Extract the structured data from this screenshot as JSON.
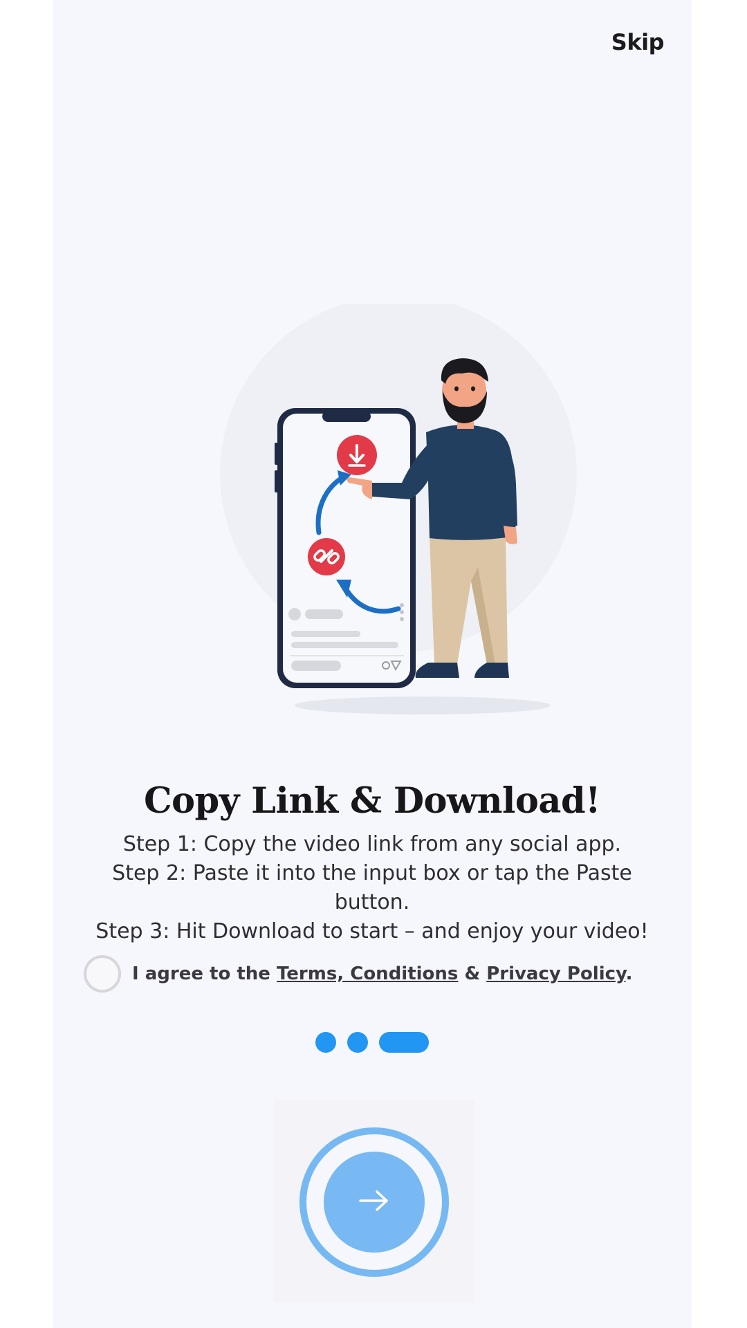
{
  "header": {
    "skip_label": "Skip"
  },
  "illustration": {
    "icon": "person-pointing-at-phone-illustration"
  },
  "content": {
    "title": "Copy Link & Download!",
    "steps": [
      "Step 1: Copy the video link from any social app.",
      "Step 2: Paste it into the input box or tap the Paste button.",
      "Step 3: Hit Download to start – and enjoy your video!"
    ]
  },
  "agreement": {
    "prefix": "I agree to the ",
    "terms_link": "Terms, Conditions",
    "separator": " & ",
    "privacy_link": "Privacy Policy",
    "suffix": ".",
    "checked": false
  },
  "pager": {
    "total": 3,
    "active_index": 2
  },
  "next_button": {
    "icon": "arrow-right-icon"
  },
  "colors": {
    "background": "#f6f7fc",
    "accent": "#2196f3",
    "accent_light": "#78b9f3",
    "download_red": "#e23a48"
  }
}
